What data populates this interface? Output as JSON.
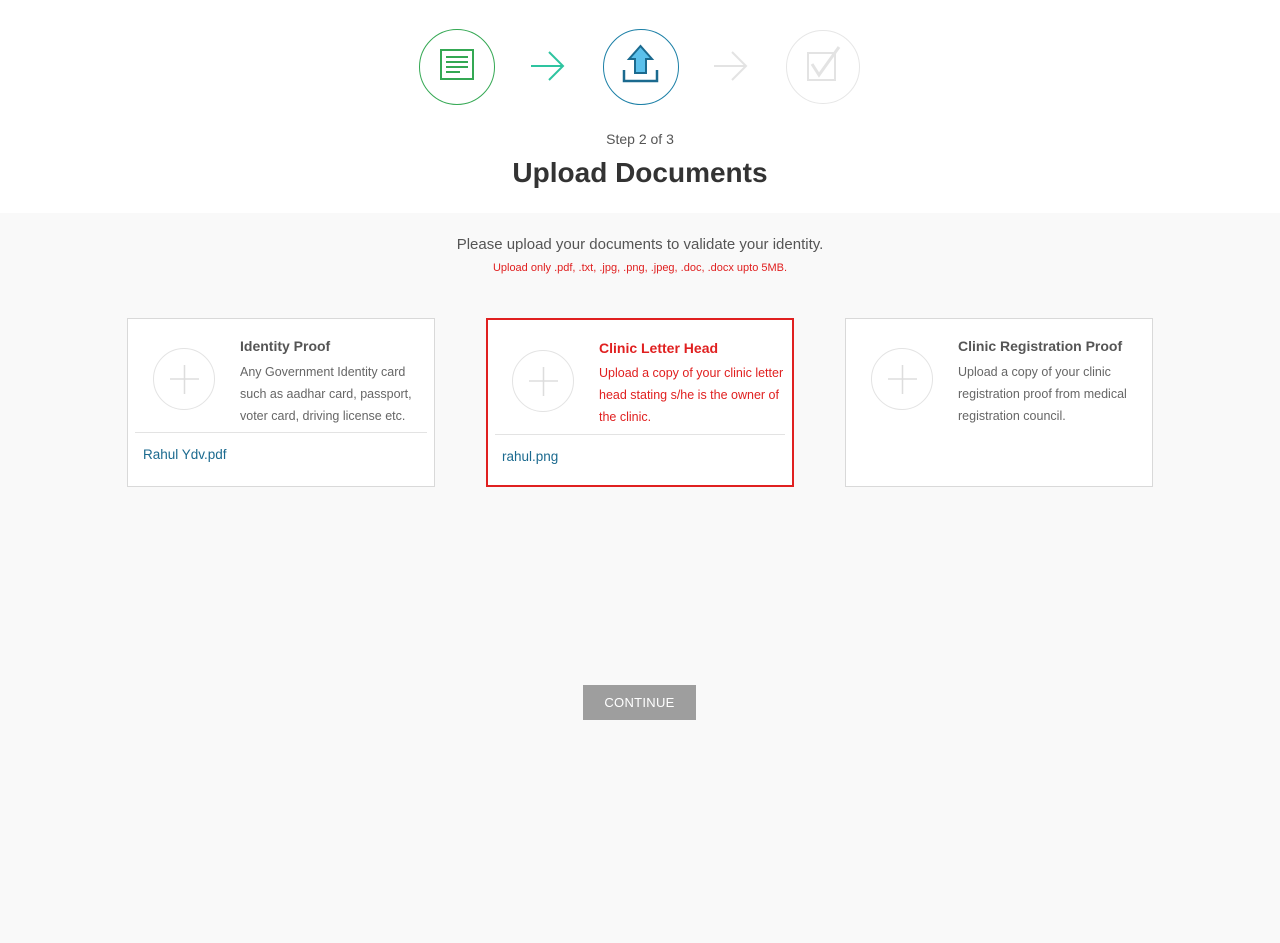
{
  "stepper": {
    "step_label": "Step 2 of 3",
    "steps": [
      {
        "icon": "document-icon",
        "state": "completed",
        "color": "#34a853"
      },
      {
        "icon": "upload-icon",
        "state": "current",
        "color": "#1b7fa6"
      },
      {
        "icon": "checkmark-icon",
        "state": "pending",
        "color": "#e6e6e6"
      }
    ]
  },
  "page": {
    "title": "Upload Documents",
    "intro": "Please upload your documents to validate your identity.",
    "note": "Upload only .pdf, .txt, .jpg, .png, .jpeg, .doc, .docx upto 5MB."
  },
  "cards": [
    {
      "title": "Identity Proof",
      "description": "Any Government Identity card such as aadhar card, passport, voter card, driving license etc.",
      "file": "Rahul Ydv.pdf",
      "error": false
    },
    {
      "title": "Clinic Letter Head",
      "description": "Upload a copy of your clinic letter head stating s/he is the owner of the clinic.",
      "file": "rahul.png",
      "error": true
    },
    {
      "title": "Clinic Registration Proof",
      "description": "Upload a copy of your clinic registration proof from medical registration council.",
      "file": "",
      "error": false
    }
  ],
  "actions": {
    "continue_label": "CONTINUE"
  },
  "colors": {
    "error": "#e02020",
    "link": "#1b6a8f",
    "button": "#9e9e9e",
    "step_done": "#34a853",
    "step_current": "#1b7fa6"
  }
}
